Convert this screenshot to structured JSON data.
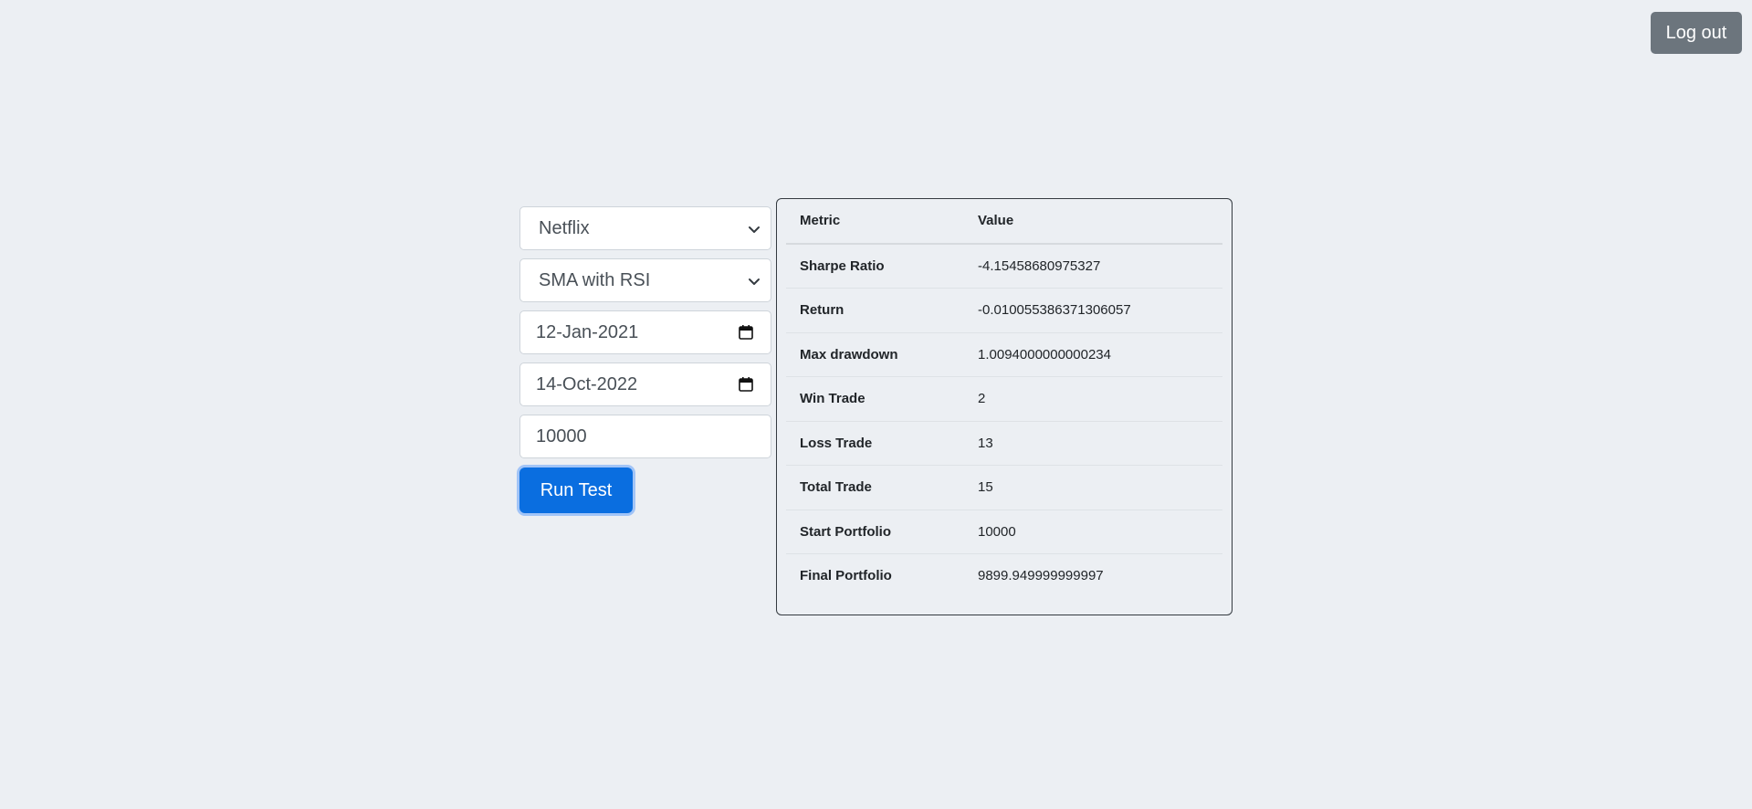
{
  "header": {
    "logout_label": "Log out"
  },
  "form": {
    "company": "Netflix",
    "strategy": "SMA with RSI",
    "start_date": "12-Jan-2021",
    "end_date": "14-Oct-2022",
    "capital": "10000",
    "run_label": "Run Test"
  },
  "results": {
    "headers": {
      "metric": "Metric",
      "value": "Value"
    },
    "rows": [
      {
        "metric": "Sharpe Ratio",
        "value": "-4.15458680975327"
      },
      {
        "metric": "Return",
        "value": "-0.010055386371306057"
      },
      {
        "metric": "Max drawdown",
        "value": "1.0094000000000234"
      },
      {
        "metric": "Win Trade",
        "value": "2"
      },
      {
        "metric": "Loss Trade",
        "value": "13"
      },
      {
        "metric": "Total Trade",
        "value": "15"
      },
      {
        "metric": "Start Portfolio",
        "value": "10000"
      },
      {
        "metric": "Final Portfolio",
        "value": "9899.949999999997"
      }
    ]
  },
  "icons": {
    "dropdown": "chevron-down-icon",
    "date": "calendar-icon"
  },
  "colors": {
    "background": "#eceff3",
    "primary": "#0a6ee0",
    "secondary": "#6c757d"
  }
}
